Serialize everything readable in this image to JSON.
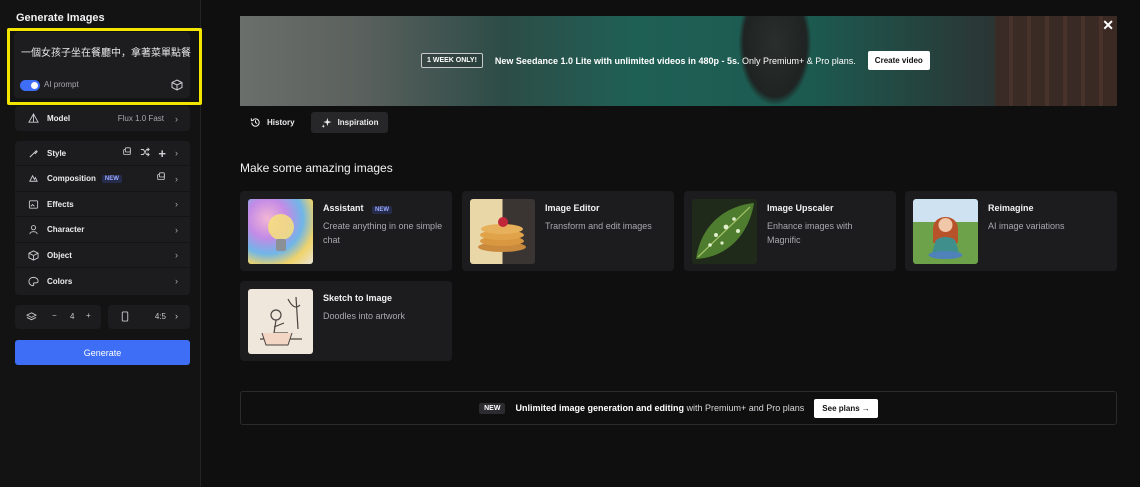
{
  "sidebar": {
    "title": "Generate Images",
    "prompt_text": "一個女孩子坐在餐廳中，拿著菜單點餐",
    "ai_prompt_label": "AI prompt",
    "model": {
      "label": "Model",
      "value": "Flux 1.0 Fast"
    },
    "options": [
      {
        "label": "Style",
        "icon": "style-icon"
      },
      {
        "label": "Composition",
        "icon": "composition-icon",
        "badge": "NEW"
      },
      {
        "label": "Effects",
        "icon": "effects-icon"
      },
      {
        "label": "Character",
        "icon": "character-icon"
      },
      {
        "label": "Object",
        "icon": "object-icon"
      },
      {
        "label": "Colors",
        "icon": "colors-icon"
      }
    ],
    "count": {
      "minus": "−",
      "value": "4",
      "plus": "+"
    },
    "aspect_ratio": "4:5",
    "generate_label": "Generate"
  },
  "banner": {
    "badge": "1 WEEK ONLY!",
    "text_bold": "New Seedance 1.0 Lite with unlimited videos in 480p - 5s.",
    "text_rest": " Only Premium+ & Pro plans.",
    "button": "Create video",
    "close": "✕"
  },
  "tabs": [
    {
      "label": "History",
      "icon": "history-icon"
    },
    {
      "label": "Inspiration",
      "icon": "sparkle-icon"
    }
  ],
  "section_title": "Make some amazing images",
  "cards": [
    {
      "title": "Assistant",
      "badge": "NEW",
      "desc": "Create anything in one simple chat"
    },
    {
      "title": "Image Editor",
      "desc": "Transform and edit images"
    },
    {
      "title": "Image Upscaler",
      "desc": "Enhance images with Magnific"
    },
    {
      "title": "Reimagine",
      "desc": "AI image variations"
    },
    {
      "title": "Sketch to Image",
      "desc": "Doodles into artwork"
    }
  ],
  "plans": {
    "badge": "NEW",
    "text_bold": "Unlimited image generation and editing",
    "text_rest": " with Premium+ and Pro plans",
    "button": "See plans",
    "button_arrow": "→"
  },
  "colors": {
    "accent": "#3d6ef5",
    "highlight": "#f2e600",
    "background": "#0f0f10"
  }
}
